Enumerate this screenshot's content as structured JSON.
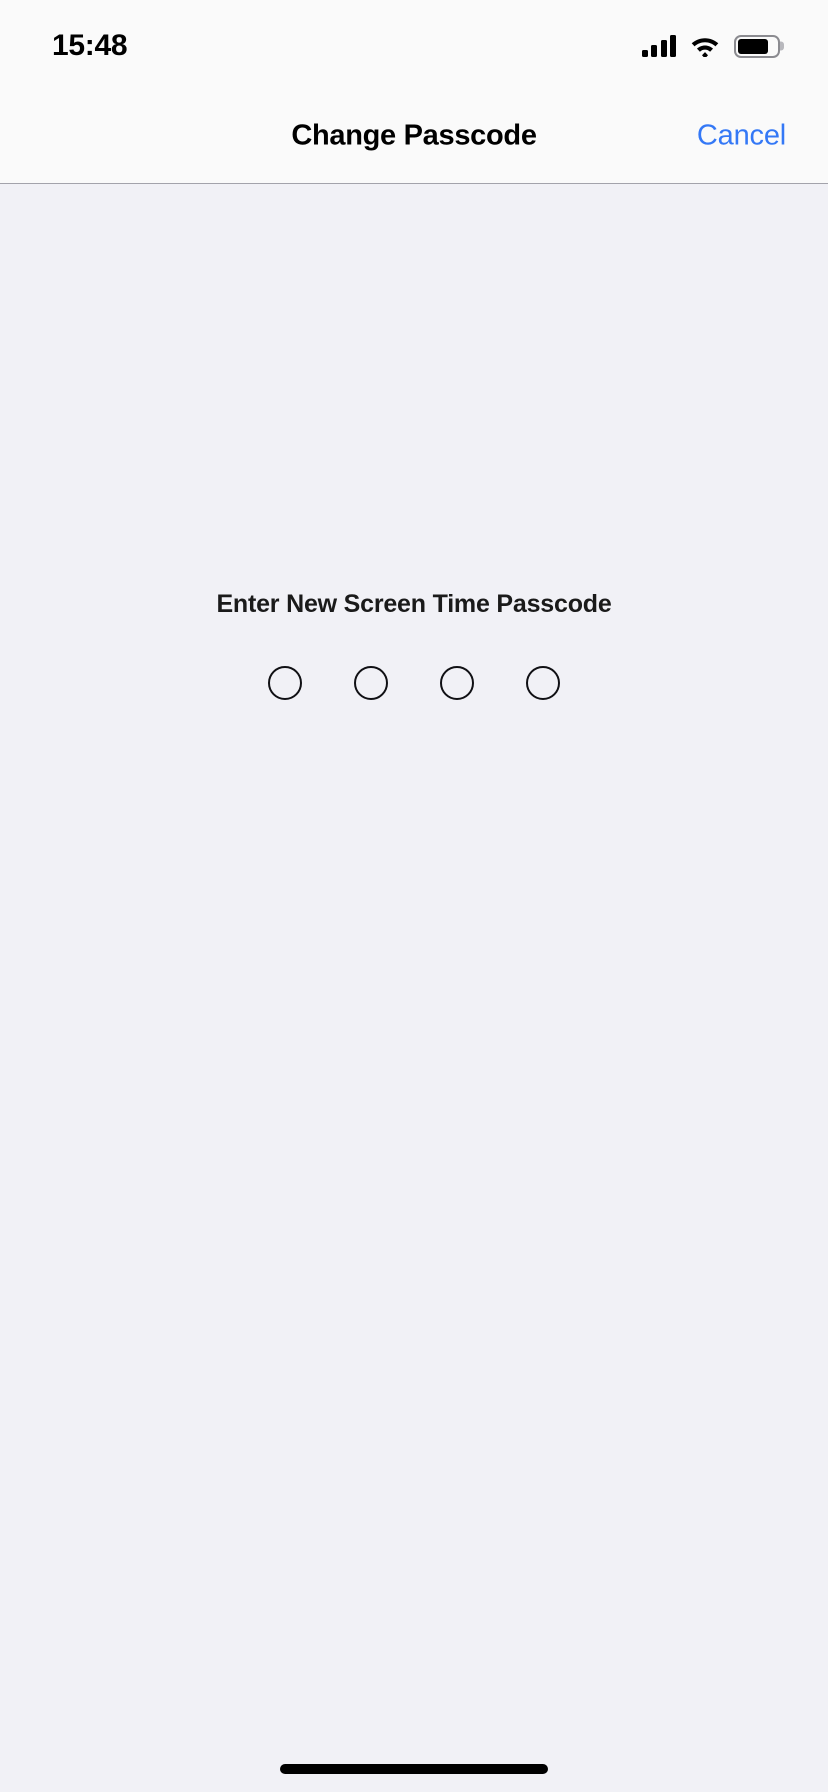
{
  "status_bar": {
    "time": "15:48",
    "cellular_icon": "cellular-signal-icon",
    "cellular_bars_total": 4,
    "cellular_bars_active": 4,
    "wifi_icon": "wifi-icon",
    "battery_icon": "battery-icon",
    "battery_fill_percent": 78
  },
  "nav_bar": {
    "title": "Change Passcode",
    "cancel_label": "Cancel",
    "cancel_color": "#3478f6"
  },
  "main": {
    "prompt": "Enter New Screen Time Passcode",
    "passcode": {
      "length": 4,
      "entered": 0,
      "dots": [
        {
          "name": "passcode-dot-1",
          "filled": false
        },
        {
          "name": "passcode-dot-2",
          "filled": false
        },
        {
          "name": "passcode-dot-3",
          "filled": false
        },
        {
          "name": "passcode-dot-4",
          "filled": false
        }
      ]
    }
  },
  "system": {
    "home_indicator": "home-indicator"
  },
  "colors": {
    "background": "#f1f1f6",
    "bar_background": "#fafafa",
    "accent": "#3478f6",
    "text_primary": "#000000",
    "separator": "#a3a3ab"
  }
}
